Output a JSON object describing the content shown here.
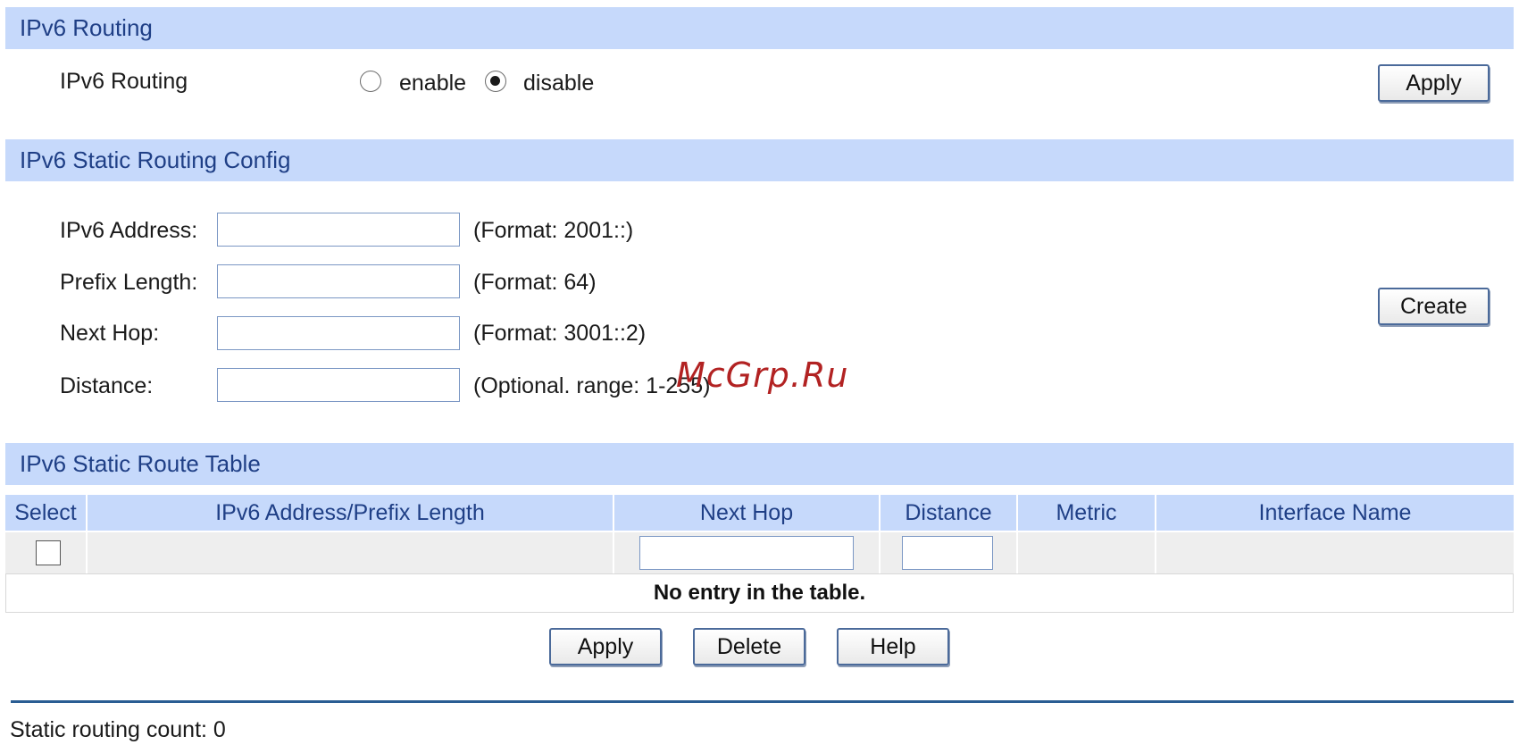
{
  "routing": {
    "section_title": "IPv6 Routing",
    "row_label": "IPv6 Routing",
    "option_enable": "enable",
    "option_disable": "disable",
    "selected": "disable",
    "apply_label": "Apply"
  },
  "static_config": {
    "section_title": "IPv6 Static Routing Config",
    "fields": [
      {
        "label": "IPv6 Address:",
        "value": "",
        "hint": "(Format: 2001::)"
      },
      {
        "label": "Prefix Length:",
        "value": "",
        "hint": "(Format: 64)"
      },
      {
        "label": "Next Hop:",
        "value": "",
        "hint": "(Format: 3001::2)"
      },
      {
        "label": "Distance:",
        "value": "",
        "hint": "(Optional. range: 1-255)"
      }
    ],
    "create_label": "Create"
  },
  "route_table": {
    "section_title": "IPv6 Static Route Table",
    "columns": [
      "Select",
      "IPv6 Address/Prefix Length",
      "Next Hop",
      "Distance",
      "Metric",
      "Interface Name"
    ],
    "empty_message": "No entry in the table.",
    "buttons": {
      "apply": "Apply",
      "delete": "Delete",
      "help": "Help"
    }
  },
  "footer": {
    "count_text": "Static routing count: 0"
  },
  "watermark": "McGrp.Ru",
  "colors": {
    "section_bg": "#c6d9fb",
    "section_text": "#1f3f86",
    "divider": "#2a5d93"
  }
}
